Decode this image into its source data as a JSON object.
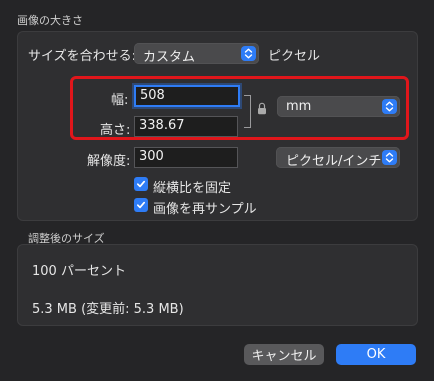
{
  "image_size": {
    "title": "画像の大きさ",
    "fit_label": "サイズを合わせる:",
    "fit_value": "カスタム",
    "fit_unit": "ピクセル",
    "width_label": "幅:",
    "width_value": "508",
    "height_label": "高さ:",
    "height_value": "338.67",
    "size_unit": "mm",
    "resolution_label": "解像度:",
    "resolution_value": "300",
    "resolution_unit": "ピクセル/インチ",
    "keep_ratio_label": "縦横比を固定",
    "keep_ratio_checked": true,
    "resample_label": "画像を再サンプル",
    "resample_checked": true
  },
  "adjusted_size": {
    "title": "調整後のサイズ",
    "percent_text": "100 パーセント",
    "file_size_text": "5.3 MB (変更前: 5.3 MB)"
  },
  "buttons": {
    "cancel": "キャンセル",
    "ok": "OK"
  },
  "colors": {
    "accent": "#2e7cf6",
    "highlight_frame": "#e0161b",
    "background": "#252527"
  }
}
